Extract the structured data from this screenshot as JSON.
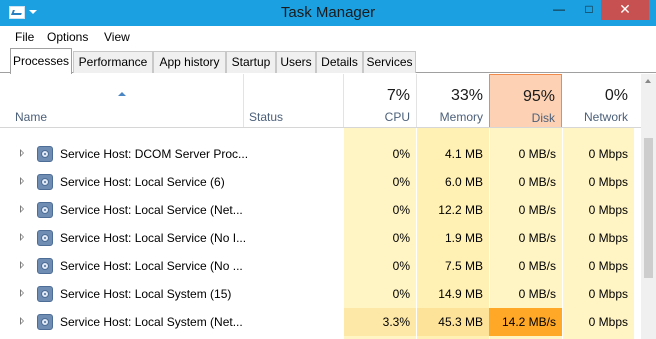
{
  "window": {
    "title": "Task Manager",
    "minimize_glyph": "—",
    "maximize_glyph": "□",
    "close_glyph": "✕"
  },
  "menu": [
    "File",
    "Options",
    "View"
  ],
  "tabs": [
    "Processes",
    "Performance",
    "App history",
    "Startup",
    "Users",
    "Details",
    "Services"
  ],
  "active_tab": "Processes",
  "columns": {
    "name": "Name",
    "status": "Status",
    "cpu": {
      "percent": "7%",
      "label": "CPU"
    },
    "memory": {
      "percent": "33%",
      "label": "Memory"
    },
    "disk": {
      "percent": "95%",
      "label": "Disk"
    },
    "network": {
      "percent": "0%",
      "label": "Network"
    }
  },
  "colors": {
    "titlebar": "#1ba1e2",
    "cpu_bg": "#fff4c4",
    "memory_bg": "#fff0b3",
    "disk_bg": "#fff4c4",
    "disk_header": "#fcd1b4",
    "disk_header_border": "#f08a4b",
    "high_usage": "#ffa726",
    "cpu_highlight": "#fde8a8"
  },
  "processes": [
    {
      "name": "Service Host: DCOM Server Proc...",
      "cpu": "0%",
      "memory": "4.1 MB",
      "disk": "0 MB/s",
      "network": "0 Mbps"
    },
    {
      "name": "Service Host: Local Service (6)",
      "cpu": "0%",
      "memory": "6.0 MB",
      "disk": "0 MB/s",
      "network": "0 Mbps"
    },
    {
      "name": "Service Host: Local Service (Net...",
      "cpu": "0%",
      "memory": "12.2 MB",
      "disk": "0 MB/s",
      "network": "0 Mbps"
    },
    {
      "name": "Service Host: Local Service (No I...",
      "cpu": "0%",
      "memory": "1.9 MB",
      "disk": "0 MB/s",
      "network": "0 Mbps"
    },
    {
      "name": "Service Host: Local Service (No ...",
      "cpu": "0%",
      "memory": "7.5 MB",
      "disk": "0 MB/s",
      "network": "0 Mbps"
    },
    {
      "name": "Service Host: Local System (15)",
      "cpu": "0%",
      "memory": "14.9 MB",
      "disk": "0 MB/s",
      "network": "0 Mbps"
    },
    {
      "name": "Service Host: Local System (Net...",
      "cpu": "3.3%",
      "memory": "45.3 MB",
      "disk": "14.2 MB/s",
      "network": "0 Mbps",
      "highlight": true
    }
  ]
}
